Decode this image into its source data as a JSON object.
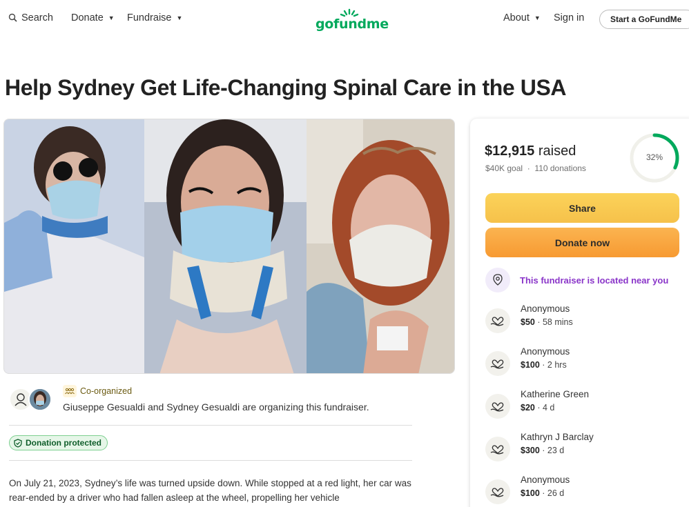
{
  "nav": {
    "search": "Search",
    "donate": "Donate",
    "fundraise": "Fundraise",
    "about": "About",
    "signin": "Sign in",
    "start": "Start a GoFundMe",
    "logo": "gofundme"
  },
  "title": "Help Sydney Get Life-Changing Spinal Care in the USA",
  "organizer": {
    "tag": "Co-organized",
    "text": "Giuseppe Gesualdi and Sydney Gesualdi are organizing this fundraiser."
  },
  "badge": "Donation protected",
  "story": "On July 21, 2023, Sydney’s life was turned upside down. While stopped at a red light, her car was rear-ended by a driver who had fallen asleep at the wheel, propelling her vehicle",
  "stats": {
    "raised_amount": "$12,915",
    "raised_suffix": "raised",
    "goal": "$40K goal",
    "donations": "110 donations",
    "percent": "32%",
    "progress_fraction": 0.32
  },
  "buttons": {
    "share": "Share",
    "donate": "Donate now"
  },
  "near": "This fundraiser is located near you",
  "donations": [
    {
      "name": "Anonymous",
      "amount": "$50",
      "time": "58 mins"
    },
    {
      "name": "Anonymous",
      "amount": "$100",
      "time": "2 hrs"
    },
    {
      "name": "Katherine Green",
      "amount": "$20",
      "time": "4 d"
    },
    {
      "name": "Kathryn J Barclay",
      "amount": "$300",
      "time": "23 d"
    },
    {
      "name": "Anonymous",
      "amount": "$100",
      "time": "26 d"
    }
  ],
  "colors": {
    "brand": "#02a95c",
    "share_button": "#f6c14a",
    "donate_button": "#f79a32",
    "near_text": "#8a35c9",
    "progress": "#02a95c"
  }
}
